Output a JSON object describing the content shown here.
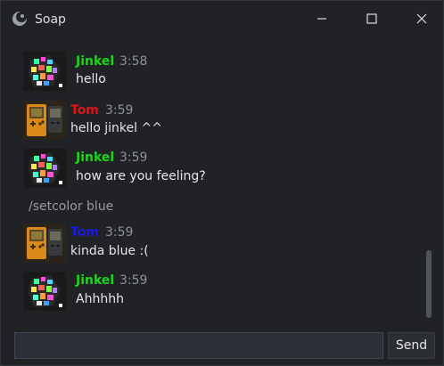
{
  "window": {
    "title": "Soap",
    "icon": "soap-logo-icon",
    "controls": [
      "minimize-icon",
      "maximize-icon",
      "close-icon"
    ]
  },
  "colors": {
    "background": "#202225",
    "jinkel": "#1bd51b",
    "tom_red": "#e01414",
    "tom_blue": "#1818e8",
    "timestamp": "#8e9297",
    "message_text": "#e6e6e6",
    "system_text": "#9a9a9a"
  },
  "messages": [
    {
      "author": "Jinkel",
      "time": "3:58",
      "text": "hello",
      "avatar": "jinkel-avatar-image"
    },
    {
      "author": "Tom",
      "time": "3:59",
      "text": "hello jinkel ^^",
      "avatar": "tom-gameboy-avatar-image"
    },
    {
      "author": "Jinkel",
      "time": "3:59",
      "text": "how are you feeling?",
      "avatar": "jinkel-avatar-image"
    },
    {
      "system": "/setcolor blue"
    },
    {
      "author": "Tom",
      "time": "3:59",
      "text": "kinda blue :(",
      "avatar": "tom-gameboy-avatar-image"
    },
    {
      "author": "Jinkel",
      "time": "3:59",
      "text": "Ahhhhh",
      "avatar": "jinkel-avatar-image"
    }
  ],
  "composer": {
    "input_value": "",
    "send_label": "Send"
  }
}
